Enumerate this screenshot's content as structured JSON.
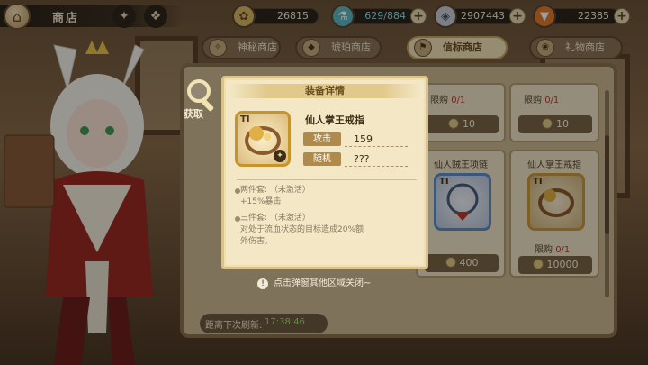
{
  "topbar": {
    "title": "商店",
    "home_icon": "home-icon",
    "resources": [
      {
        "name": "gold",
        "icon": "coin-icon",
        "value": "26815"
      },
      {
        "name": "stamina",
        "icon": "flask-icon",
        "value": "629/884"
      },
      {
        "name": "silver",
        "icon": "silver-coin-icon",
        "value": "2907443"
      },
      {
        "name": "carrot",
        "icon": "carrot-icon",
        "value": "22385"
      }
    ]
  },
  "tabs": [
    {
      "label": "神秘商店",
      "active": false
    },
    {
      "label": "琥珀商店",
      "active": false
    },
    {
      "label": "信标商店",
      "active": true
    },
    {
      "label": "礼物商店",
      "active": false
    }
  ],
  "shop": {
    "cards": [
      {
        "name": "",
        "limit_label": "限购",
        "limit_value": "0/1",
        "price": "10"
      },
      {
        "name": "",
        "limit_label": "限购",
        "limit_value": "0/1",
        "price": "10"
      },
      {
        "name": "仙人贼王项链",
        "limit_label": "",
        "limit_value": "",
        "price": "400"
      },
      {
        "name": "仙人掌王戒指",
        "limit_label": "限购",
        "limit_value": "0/1",
        "price": "10000"
      }
    ],
    "refresh_label": "距离下次刷新:",
    "refresh_time": "17:38:46"
  },
  "acquire_label": "获取",
  "popup": {
    "header": "装备详情",
    "tier": "TI",
    "item_name": "仙人掌王戒指",
    "stats": [
      {
        "label": "攻击",
        "value": "159"
      },
      {
        "label": "随机",
        "value": "???"
      }
    ],
    "set_two_line1": "两件套:  （未激活）",
    "set_two_line2": "+15%暴击",
    "set_three_line1": "三件套:  （未激活）",
    "set_three_line2": "对处于流血状态的目标造成20%额",
    "set_three_line3": "外伤害。"
  },
  "close_hint": "点击弹窗其他区域关闭~",
  "colors": {
    "accent_gold": "#c6942d",
    "limit_red": "#c0392b",
    "refresh_green": "#9ee36a"
  }
}
